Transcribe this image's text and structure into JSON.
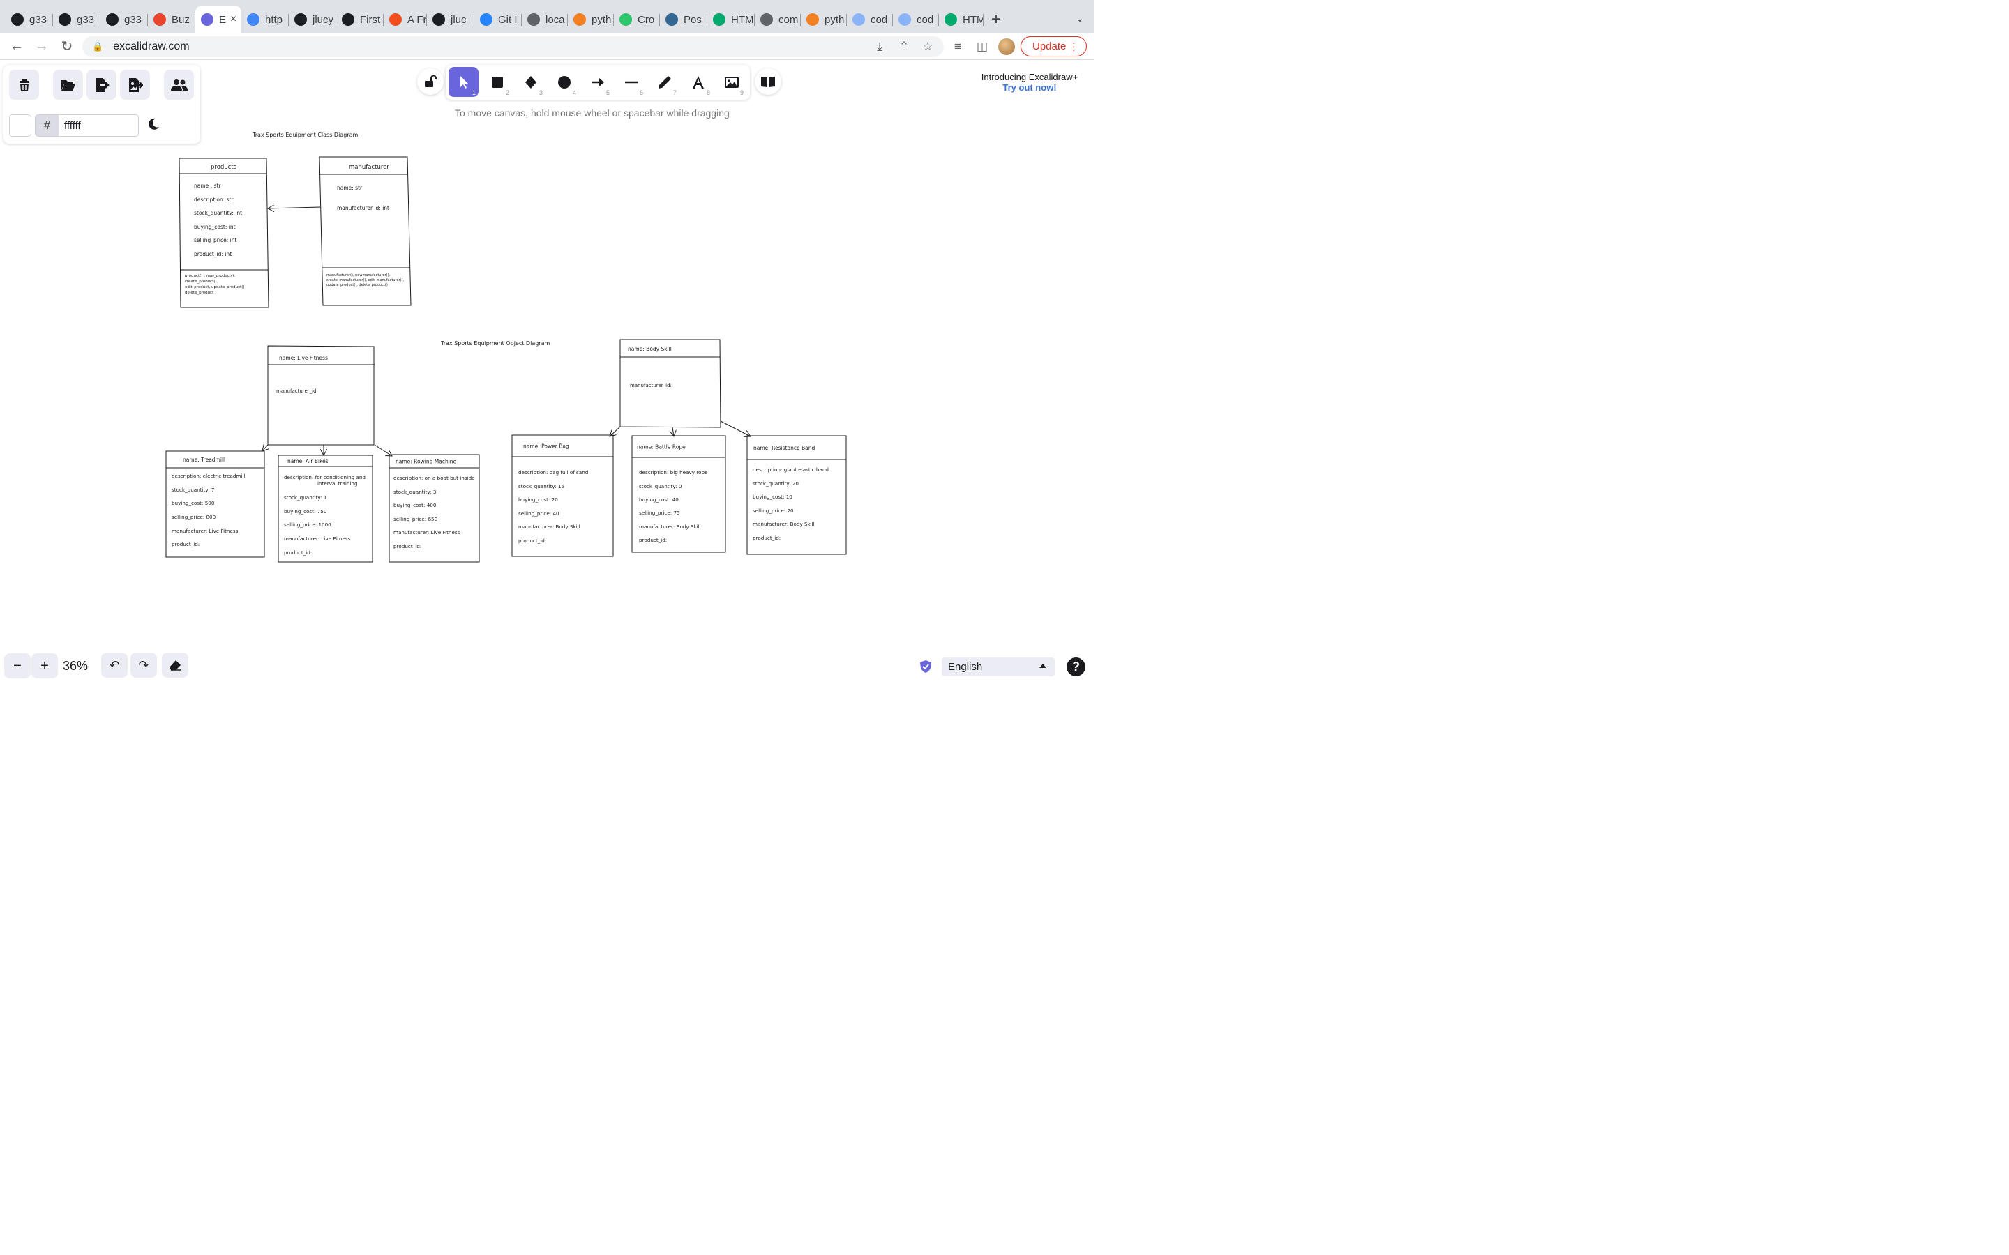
{
  "browser": {
    "tabs": [
      {
        "label": "g33",
        "icon": "github-icon",
        "color": "#1b1f23"
      },
      {
        "label": "g33",
        "icon": "github-icon",
        "color": "#1b1f23"
      },
      {
        "label": "g33",
        "icon": "github-icon",
        "color": "#1b1f23"
      },
      {
        "label": "Buz",
        "icon": "tomato-icon",
        "color": "#e8452c"
      },
      {
        "label": "E",
        "icon": "excalidraw-icon",
        "color": "#6965db",
        "active": true
      },
      {
        "label": "http",
        "icon": "google-icon",
        "color": "#4285f4"
      },
      {
        "label": "jlucy",
        "icon": "github-icon",
        "color": "#1b1f23"
      },
      {
        "label": "First",
        "icon": "github-icon",
        "color": "#1b1f23"
      },
      {
        "label": "A Fr",
        "icon": "figma-icon",
        "color": "#f24e1e"
      },
      {
        "label": "jluc",
        "icon": "github-icon",
        "color": "#1b1f23"
      },
      {
        "label": "Git I",
        "icon": "atlassian-icon",
        "color": "#2684ff"
      },
      {
        "label": "loca",
        "icon": "globe-icon",
        "color": "#5f6368"
      },
      {
        "label": "pyth",
        "icon": "stackoverflow-icon",
        "color": "#f48024"
      },
      {
        "label": "Cro",
        "icon": "pixabay-icon",
        "color": "#2ec66d"
      },
      {
        "label": "Pos",
        "icon": "postgres-icon",
        "color": "#336791"
      },
      {
        "label": "HTM",
        "icon": "w3schools-icon",
        "color": "#04aa6d"
      },
      {
        "label": "com",
        "icon": "globe-icon",
        "color": "#5f6368"
      },
      {
        "label": "pyth",
        "icon": "stackoverflow-icon",
        "color": "#f48024"
      },
      {
        "label": "cod",
        "icon": "codepen-icon",
        "color": "#8ab4f8"
      },
      {
        "label": "cod",
        "icon": "codepen-icon",
        "color": "#8ab4f8"
      },
      {
        "label": "HTM",
        "icon": "w3schools-icon",
        "color": "#04aa6d"
      }
    ],
    "url": "excalidraw.com",
    "update_label": "Update"
  },
  "excalidraw": {
    "hex_value": "ffffff",
    "hash": "#",
    "hint": "To move canvas, hold mouse wheel or spacebar while dragging",
    "promo_title": "Introducing Excalidraw+",
    "promo_link": "Try out now!",
    "zoom": "36%",
    "language": "English",
    "help": "?",
    "tool_numbers": [
      "1",
      "2",
      "3",
      "4",
      "5",
      "6",
      "7",
      "8",
      "9"
    ]
  },
  "diagram": {
    "class_title": "Trax Sports Equipment Class Diagram",
    "object_title": "Trax Sports Equipment Object Diagram",
    "products": {
      "header": "products",
      "attrs": [
        "name : str",
        "description: str",
        "stock_quantity: int",
        "buying_cost: int",
        "selling_price: int",
        "product_id: int"
      ],
      "methods": [
        "product() , new_product(),",
        "create_product(),",
        "edit_product, update_product()",
        "delete_product"
      ]
    },
    "manufacturer": {
      "header": "manufacturer",
      "attrs": [
        "name: str",
        "manufacturer id: int"
      ],
      "methods": [
        "manufacturer(), newmanufacturer(),",
        "create_manufacturer(), edit_manufacturer(),",
        "update_product(), delete_product()"
      ]
    },
    "live_fitness": {
      "header": "name:   Live Fitness",
      "body": "manufacturer_id:"
    },
    "body_skill": {
      "header": "name:  Body Skill",
      "body": "manufacturer_id:"
    },
    "objects": [
      {
        "header": "name:   Treadmill",
        "lines": [
          "description: electric treadmill",
          "stock_quantity:  7",
          "buying_cost:  500",
          "selling_price:  800",
          "manufacturer: Live Fitness",
          "product_id:"
        ]
      },
      {
        "header": "name:    Air Bikes",
        "lines": [
          "description: for conditioning and",
          "interval training",
          "stock_quantity:  1",
          "buying_cost: 750",
          "selling_price: 1000",
          "manufacturer: Live Fitness",
          "product_id:"
        ]
      },
      {
        "header": "name: Rowing Machine",
        "lines": [
          "description: on a boat but inside",
          "stock_quantity:  3",
          "buying_cost: 400",
          "selling_price: 650",
          "manufacturer: Live Fitness",
          "product_id:"
        ]
      },
      {
        "header": "name:    Power Bag",
        "lines": [
          "description: bag full of sand",
          "stock_quantity:  15",
          "buying_cost: 20",
          "selling_price: 40",
          "manufacturer: Body Skill",
          "product_id:"
        ]
      },
      {
        "header": "name:  Battle Rope",
        "lines": [
          "description: big heavy rope",
          "stock_quantity:  0",
          "buying_cost: 40",
          "selling_price: 75",
          "manufacturer: Body Skill",
          "product_id:"
        ]
      },
      {
        "header": "name:    Resistance Band",
        "lines": [
          "description: giant elastic band",
          "stock_quantity:  20",
          "buying_cost: 10",
          "selling_price: 20",
          "manufacturer: Body Skill",
          "product_id:"
        ]
      }
    ]
  }
}
